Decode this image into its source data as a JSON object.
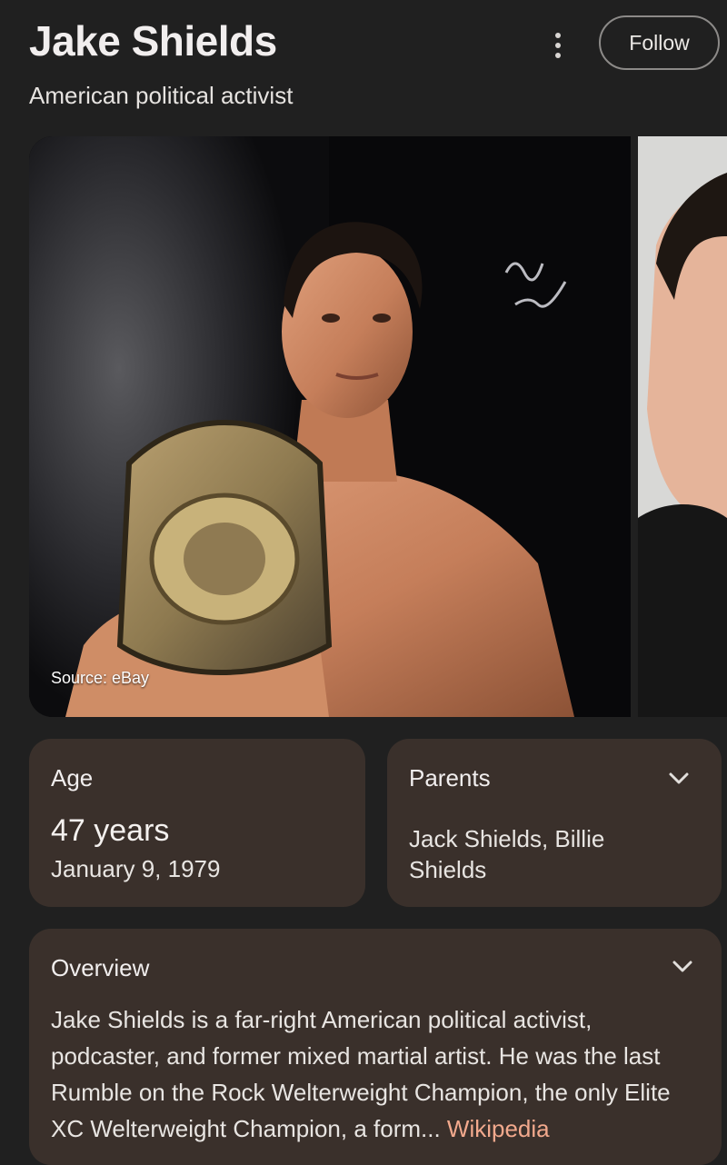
{
  "header": {
    "title": "Jake Shields",
    "subtitle": "American political activist",
    "follow_label": "Follow",
    "more_icon": "more-vert-icon"
  },
  "images": {
    "source_label": "Source: eBay"
  },
  "facts": {
    "age": {
      "label": "Age",
      "value": "47 years",
      "date": "January 9, 1979"
    },
    "parents": {
      "label": "Parents",
      "value": "Jack Shields, Billie Shields"
    }
  },
  "overview": {
    "label": "Overview",
    "text": "Jake Shields is a far-right American political activist, podcaster, and former mixed martial artist. He was the last Rumble on the Rock Welterweight Champion, the only Elite XC Welterweight Champion, a form",
    "ellipsis": "...",
    "link_label": "Wikipedia"
  },
  "colors": {
    "background": "#202020",
    "card": "#3a302b",
    "link": "#f2a98d"
  }
}
